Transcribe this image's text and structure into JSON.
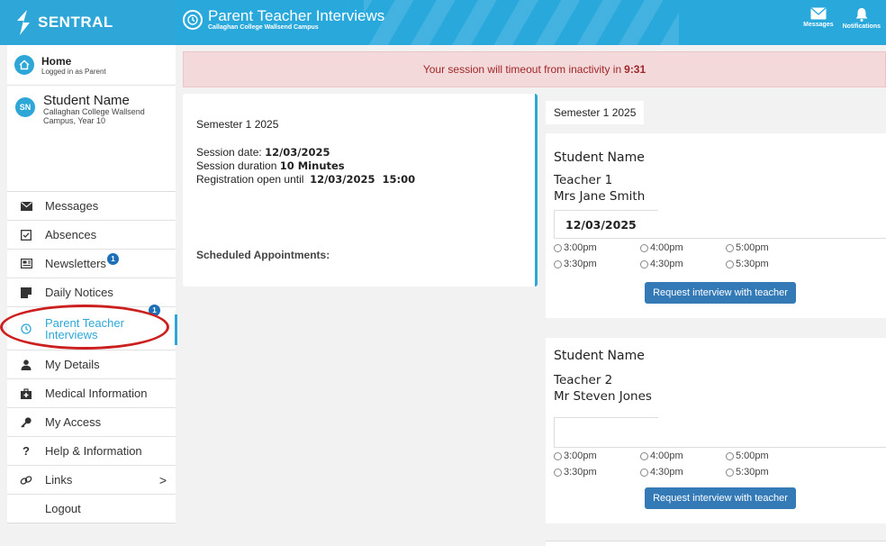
{
  "header": {
    "logo_text": "SENTRAL",
    "title": "Parent Teacher Interviews",
    "subtitle": "Callaghan College Wallsend Campus",
    "messages_label": "Messages",
    "notifications_label": "Notifications"
  },
  "sidebar": {
    "home_title": "Home",
    "home_sub": "Logged in as Parent",
    "avatar_initials": "SN",
    "student_name": "Student Name",
    "student_school": "Callaghan College Wallsend Campus, Year 10",
    "items": [
      {
        "label": "Messages",
        "icon": "envelope-icon"
      },
      {
        "label": "Absences",
        "icon": "checkbox-icon"
      },
      {
        "label": "Newsletters",
        "icon": "newspaper-icon",
        "badge": "1"
      },
      {
        "label": "Daily Notices",
        "icon": "note-icon"
      },
      {
        "label": "Parent Teacher Interviews",
        "icon": "clock-icon",
        "badge": "1",
        "active": true
      },
      {
        "label": "My Details",
        "icon": "person-icon"
      },
      {
        "label": "Medical Information",
        "icon": "medical-kit-icon"
      },
      {
        "label": "My Access",
        "icon": "key-icon"
      },
      {
        "label": "Help & Information",
        "icon": "question-icon"
      },
      {
        "label": "Links",
        "icon": "link-icon",
        "chevron": ">"
      },
      {
        "label": "Logout"
      }
    ]
  },
  "banner": {
    "text": "Your session will timeout from inactivity in",
    "time": "9:31"
  },
  "session": {
    "semester": "Semester 1 2025",
    "date_label": "Session date:",
    "date_value": "12/03/2025",
    "duration_label": "Session duration",
    "duration_value": "10 Minutes",
    "reg_label": "Registration open until",
    "reg_value": "12/03/2025  15:00",
    "scheduled_label": "Scheduled Appointments:"
  },
  "right": {
    "semester": "Semester 1 2025",
    "cards": [
      {
        "student": "Student Name",
        "teacher_num": "Teacher 1",
        "teacher_name": "Mrs Jane Smith",
        "date": "12/03/2025",
        "slots": [
          "3:00pm",
          "4:00pm",
          "5:00pm",
          "3:30pm",
          "4:30pm",
          "5:30pm"
        ],
        "button": "Request interview with teacher"
      },
      {
        "student": "Student Name",
        "teacher_num": "Teacher 2",
        "teacher_name": "Mr Steven Jones",
        "date": "",
        "slots": [
          "3:00pm",
          "4:00pm",
          "5:00pm",
          "3:30pm",
          "4:30pm",
          "5:30pm"
        ],
        "button": "Request interview with teacher"
      }
    ]
  },
  "colors": {
    "brand": "#2ea7d8",
    "banner_bg": "#f3d9d9",
    "banner_text": "#a0262a",
    "button": "#337ab7",
    "annotation_oval": "#cc1f1f"
  }
}
